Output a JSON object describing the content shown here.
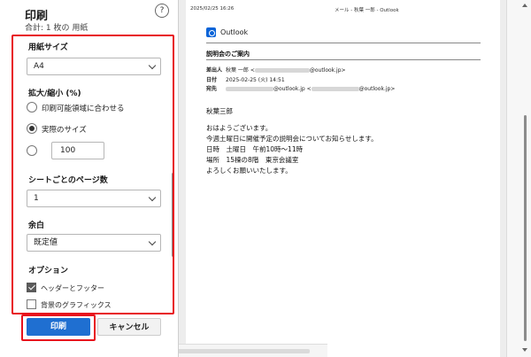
{
  "dialog": {
    "title": "印刷",
    "summary": "合計: 1 枚の 用紙",
    "help_label": "?",
    "paper_size": {
      "label": "用紙サイズ",
      "value": "A4"
    },
    "scale": {
      "label": "拡大/縮小 (%)",
      "options": [
        {
          "label": "印刷可能領域に合わせる",
          "selected": false
        },
        {
          "label": "実際のサイズ",
          "selected": true
        }
      ],
      "custom_value": "100"
    },
    "pages_per_sheet": {
      "label": "シートごとのページ数",
      "value": "1"
    },
    "margins": {
      "label": "余白",
      "value": "既定値"
    },
    "options": {
      "label": "オプション",
      "items": [
        {
          "label": "ヘッダーとフッター",
          "checked": true
        },
        {
          "label": "背景のグラフィックス",
          "checked": false
        }
      ]
    },
    "print_button": "印刷",
    "cancel_button": "キャンセル"
  },
  "preview": {
    "header_datetime": "2025/02/25 16:26",
    "header_title": "メール - 秋葉 一郎 - Outlook",
    "logo_text": "Outlook",
    "subject": "説明会のご案内",
    "from_label": "差出人",
    "from_name": "秋葉 一郎 <",
    "from_domain": "@outlook.jp>",
    "date_label": "日付",
    "date_value": "2025-02-25 (火) 14:51",
    "to_label": "宛先",
    "to_domain_1": "@outlook.jp <",
    "to_domain_2": "@outlook.jp>",
    "body": [
      "秋葉三郎",
      "おはようございます。",
      "今週土曜日に開催予定の説明会についてお知らせします。",
      "日時　土曜日　午前10時～11時",
      "場所　15棟の8階　東京会議室",
      "よろしくお願いいたします。"
    ]
  },
  "colors": {
    "accent": "#1f6fd1",
    "highlight": "#e8121c",
    "outlook_blue": "#0a64d8"
  }
}
